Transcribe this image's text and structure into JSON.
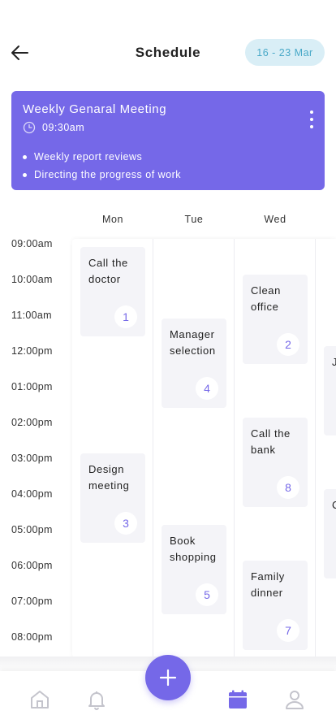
{
  "header": {
    "title": "Schedule",
    "date_range": "16 - 23 Mar"
  },
  "meeting": {
    "title": "Weekly Genaral Meeting",
    "time": "09:30am",
    "bullets": [
      "Weekly report reviews",
      "Directing the progress of work"
    ]
  },
  "days": [
    "Mon",
    "Tue",
    "Wed"
  ],
  "times": [
    "09:00am",
    "10:00am",
    "11:00am",
    "12:00pm",
    "01:00pm",
    "02:00pm",
    "03:00pm",
    "04:00pm",
    "05:00pm",
    "06:00pm",
    "07:00pm",
    "08:00pm"
  ],
  "events": [
    {
      "name": "Call the doctor",
      "num": "1"
    },
    {
      "name": "Design meeting",
      "num": "3"
    },
    {
      "name": "Manager selection",
      "num": "4"
    },
    {
      "name": "Book shopping",
      "num": "5"
    },
    {
      "name": "Clean office",
      "num": "2"
    },
    {
      "name": "Call the bank",
      "num": "8"
    },
    {
      "name": "Family dinner",
      "num": "7"
    },
    {
      "name": "J",
      "num": ""
    },
    {
      "name": "C",
      "num": ""
    }
  ],
  "colors": {
    "accent": "#7568e8",
    "pill_bg": "#d9eef6",
    "pill_text": "#49a9c8",
    "event_bg": "#f4f4f8",
    "icon_inactive": "#c4c4cc"
  },
  "icons": {
    "back": "arrow-left-icon",
    "clock": "clock-icon",
    "more": "kebab-menu-icon",
    "add": "plus-icon",
    "home": "home-icon",
    "notifications": "bell-icon",
    "calendar": "calendar-icon",
    "profile": "user-icon"
  }
}
